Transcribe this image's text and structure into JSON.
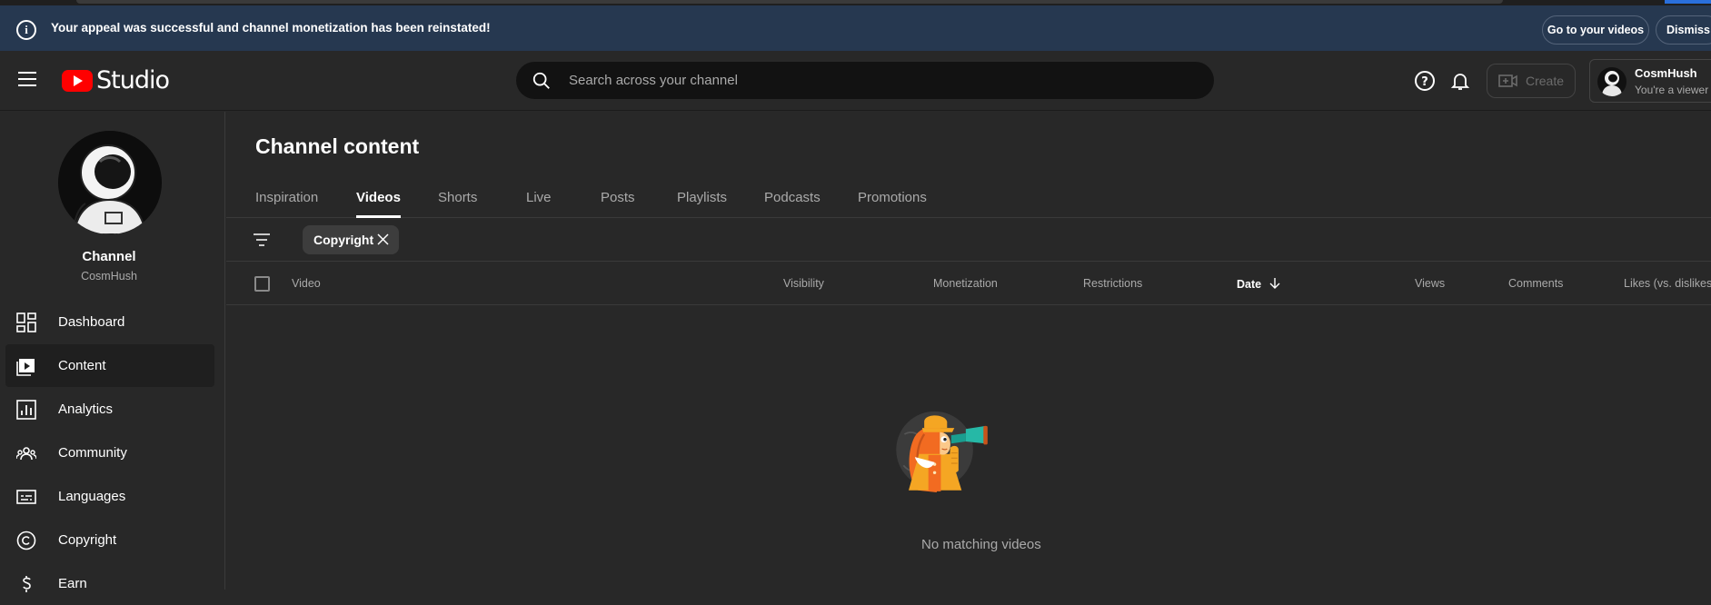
{
  "banner": {
    "message": "Your appeal was successful and channel monetization has been reinstated!",
    "go_label": "Go to your videos",
    "dismiss_label": "Dismiss"
  },
  "header": {
    "logo_text": "Studio",
    "search_placeholder": "Search across your channel",
    "create_label": "Create",
    "account_name": "CosmHush",
    "account_role": "You're a viewer"
  },
  "sidebar": {
    "channel_title": "Channel",
    "channel_name": "CosmHush",
    "items": [
      {
        "label": "Dashboard",
        "icon": "dashboard-icon"
      },
      {
        "label": "Content",
        "icon": "content-icon"
      },
      {
        "label": "Analytics",
        "icon": "analytics-icon"
      },
      {
        "label": "Community",
        "icon": "community-icon"
      },
      {
        "label": "Languages",
        "icon": "languages-icon"
      },
      {
        "label": "Copyright",
        "icon": "copyright-icon"
      },
      {
        "label": "Earn",
        "icon": "earn-icon"
      }
    ]
  },
  "main": {
    "title": "Channel content",
    "tabs": [
      "Inspiration",
      "Videos",
      "Shorts",
      "Live",
      "Posts",
      "Playlists",
      "Podcasts",
      "Promotions"
    ],
    "active_tab": "Videos",
    "filter_chip": "Copyright",
    "columns": [
      "Video",
      "Visibility",
      "Monetization",
      "Restrictions",
      "Date",
      "Views",
      "Comments",
      "Likes (vs. dislikes)"
    ],
    "sorted_column": "Date",
    "empty_message": "No matching videos"
  },
  "colors": {
    "banner_bg": "#263850",
    "brand_red": "#ff0000",
    "bg": "#282828"
  }
}
